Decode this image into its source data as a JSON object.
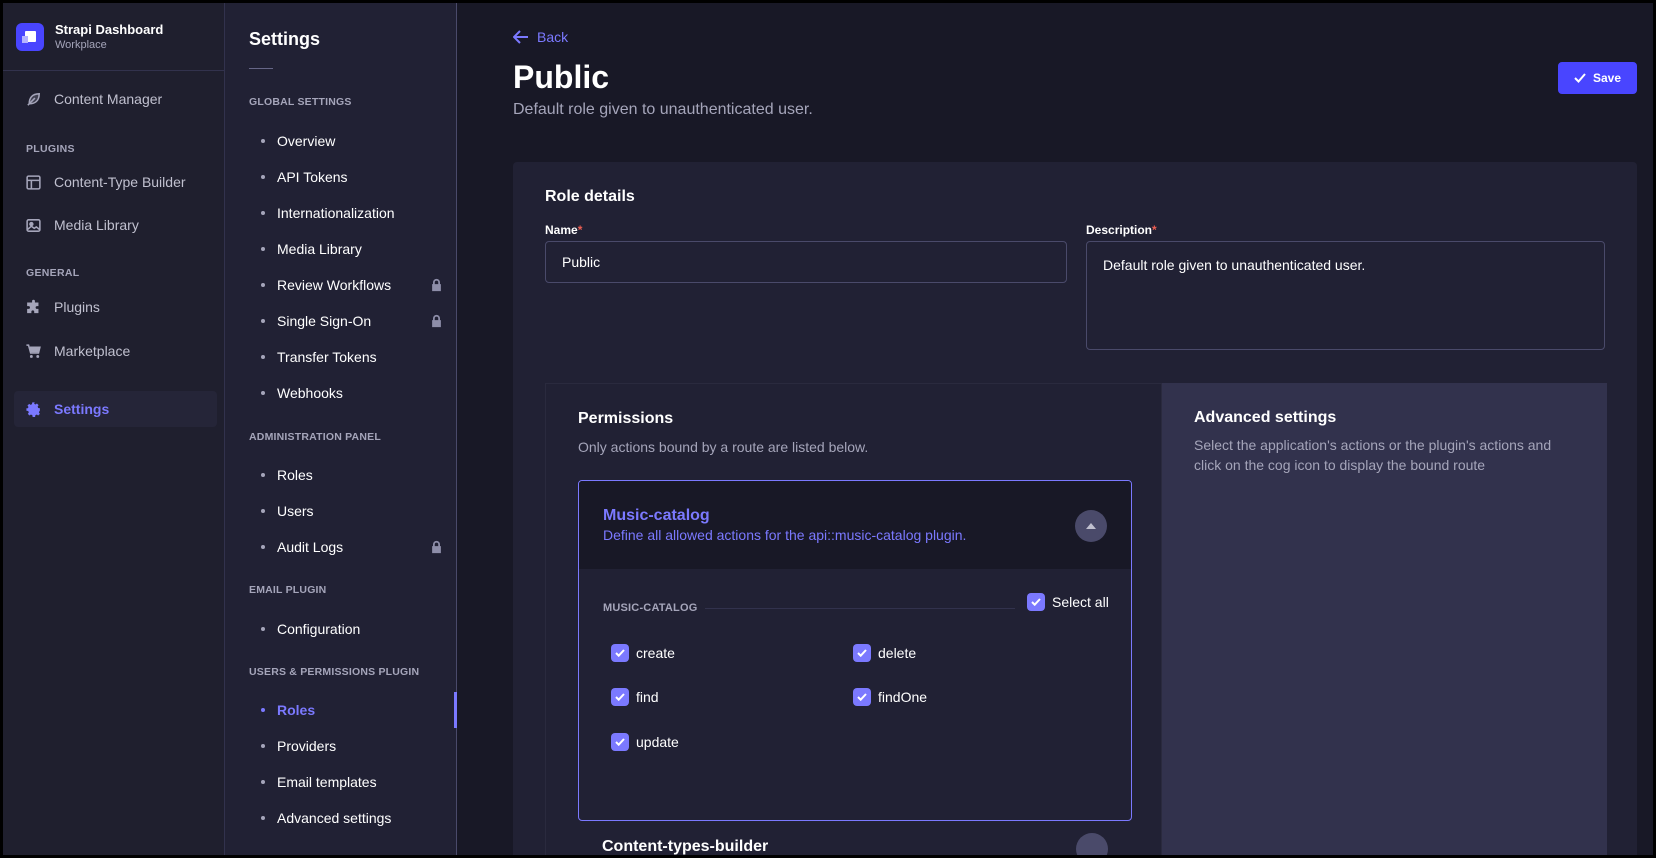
{
  "brand": {
    "title": "Strapi Dashboard",
    "subtitle": "Workplace"
  },
  "mainnav": {
    "content_manager": "Content Manager",
    "section_plugins": "PLUGINS",
    "content_type_builder": "Content-Type Builder",
    "media_library": "Media Library",
    "section_general": "GENERAL",
    "plugins": "Plugins",
    "marketplace": "Marketplace",
    "settings": "Settings"
  },
  "subnav": {
    "title": "Settings",
    "global_section": "GLOBAL SETTINGS",
    "global_items": [
      "Overview",
      "API Tokens",
      "Internationalization",
      "Media Library",
      "Review Workflows",
      "Single Sign-On",
      "Transfer Tokens",
      "Webhooks"
    ],
    "admin_section": "ADMINISTRATION PANEL",
    "admin_items": [
      "Roles",
      "Users",
      "Audit Logs"
    ],
    "email_section": "EMAIL PLUGIN",
    "email_items": [
      "Configuration"
    ],
    "up_section": "USERS & PERMISSIONS PLUGIN",
    "up_items": [
      "Roles",
      "Providers",
      "Email templates",
      "Advanced settings"
    ]
  },
  "header": {
    "back": "Back",
    "title": "Public",
    "description": "Default role given to unauthenticated user.",
    "save": "Save"
  },
  "role": {
    "card_title": "Role details",
    "name_label": "Name",
    "name_value": "Public",
    "description_label": "Description",
    "description_value": "Default role given to unauthenticated user.",
    "required_mark": "*"
  },
  "permissions": {
    "title": "Permissions",
    "subtitle": "Only actions bound by a route are listed below.",
    "accordion": {
      "title": "Music-catalog",
      "description": "Define all allowed actions for the api::music-catalog plugin.",
      "group_label": "MUSIC-CATALOG",
      "select_all": "Select all",
      "actions": [
        "create",
        "delete",
        "find",
        "findOne",
        "update"
      ]
    },
    "next_accordion_title": "Content-types-builder"
  },
  "advanced": {
    "title": "Advanced settings",
    "text": "Select the application's actions or the plugin's actions and click on the cog icon to display the bound route"
  },
  "colors": {
    "accent": "#7b79ff",
    "primary": "#4945ff",
    "background": "#181826",
    "panel": "#212134"
  }
}
